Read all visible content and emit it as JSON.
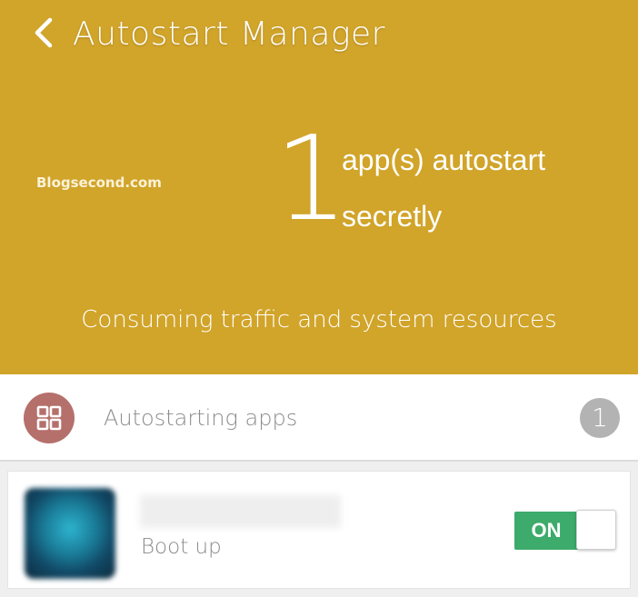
{
  "header": {
    "title": "Autostart Manager",
    "back_icon": "chevron-left-icon",
    "watermark": "Blogsecond.com",
    "count": "1",
    "count_line1": "app(s)  autostart",
    "count_line2": "secretly",
    "subtitle": "Consuming traffic and system resources",
    "background_color": "#d1a42a"
  },
  "section": {
    "icon": "grid-icon",
    "icon_color": "#b5706c",
    "label": "Autostarting apps",
    "badge": "1"
  },
  "apps": [
    {
      "icon": "app-icon",
      "sub_label": "Boot up",
      "toggle_label": "ON",
      "toggle_on": true,
      "toggle_color": "#3cab6b"
    }
  ]
}
